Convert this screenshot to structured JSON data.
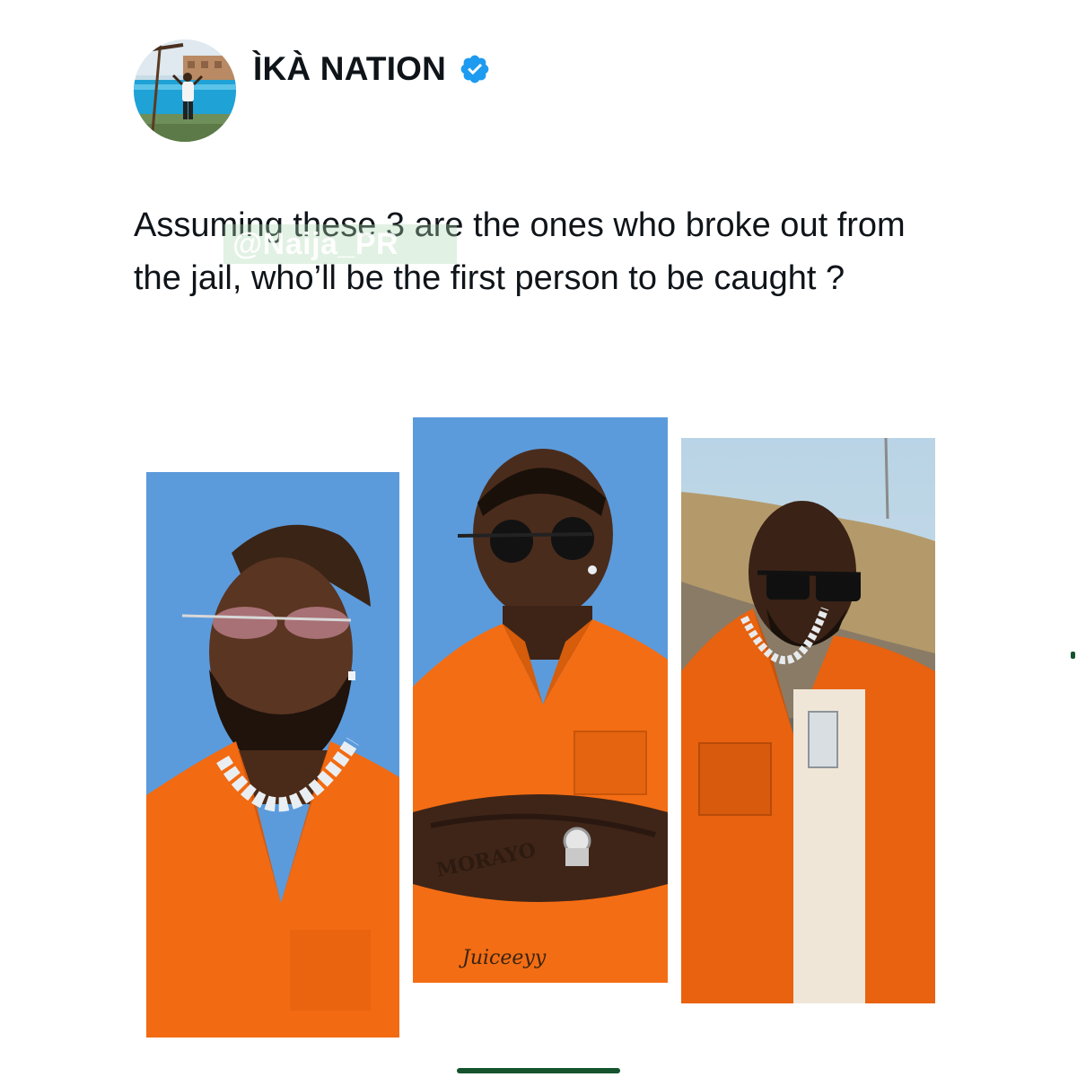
{
  "author": {
    "display_name": "ÌKÀ NATION",
    "verified": true,
    "avatar_icon": "avatar-poolside-photo"
  },
  "tweet": {
    "text": "Assuming these 3 are the ones who broke out from the jail, who’ll be the first person to be caught ?",
    "watermark": "@Naija_PR"
  },
  "media": [
    {
      "label": "photo-person-1",
      "backdrop": "#5b9bdc",
      "outfit": "#f26a12"
    },
    {
      "label": "photo-person-2",
      "backdrop": "#5b9bdc",
      "outfit": "#f36d14",
      "tattoo_text": "MORAYO",
      "signature": "Juiceeyy"
    },
    {
      "label": "photo-person-3",
      "backdrop": "#a8c4d8",
      "outfit": "#e8620f"
    }
  ],
  "colors": {
    "text": "#0f1419",
    "verified": "#1d9bf0",
    "home_indicator": "#14532d"
  }
}
